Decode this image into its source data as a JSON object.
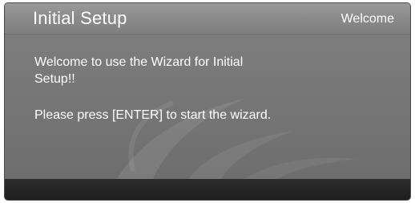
{
  "header": {
    "title": "Initial Setup",
    "step_label": "Welcome"
  },
  "content": {
    "message_1": "Welcome to use the Wizard for Initial Setup!!",
    "message_2": "Please press [ENTER] to start the wizard."
  },
  "colors": {
    "background": "#7a7a7a",
    "header": "#8a8a8a",
    "footer": "#1e1e1e",
    "text": "#ffffff"
  }
}
